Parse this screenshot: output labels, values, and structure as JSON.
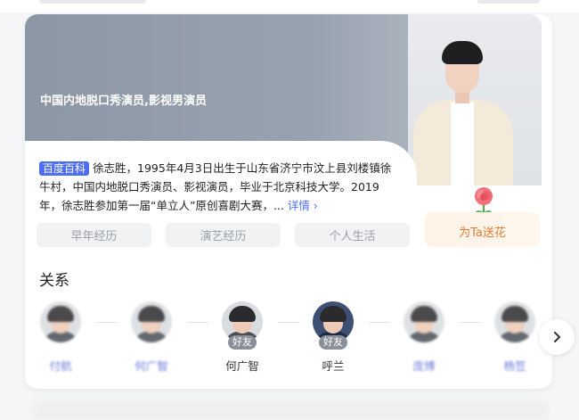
{
  "hero": {
    "tagline": "中国内地脱口秀演员,影视男演员"
  },
  "summary": {
    "badge": "百度百科",
    "text": "徐志胜，1995年4月3日出生于山东省济宁市汶上县刘楼镇徐牛村，中国内地脱口秀演员、影视演员，毕业于北京科技大学。2019年，徐志胜参加第一届“单立人”原创喜剧大赛，...",
    "more_label": "详情 ›"
  },
  "tags": [
    "早年经历",
    "演艺经历",
    "个人生活"
  ],
  "gift": {
    "label": "为Ta送花"
  },
  "relations": {
    "title": "关系",
    "items": [
      {
        "name": "付航",
        "badge": "",
        "blurred": true
      },
      {
        "name": "何广智",
        "badge": "",
        "blurred": true
      },
      {
        "name": "何广智",
        "badge": "好友",
        "blurred": false
      },
      {
        "name": "呼兰",
        "badge": "好友",
        "blurred": false
      },
      {
        "name": "庞博",
        "badge": "",
        "blurred": true
      },
      {
        "name": "杨笠",
        "badge": "",
        "blurred": true
      }
    ]
  },
  "icons": {
    "next": "chevron-right-icon",
    "rose": "rose-icon"
  },
  "colors": {
    "accent": "#4e6ef2",
    "gift_text": "#e67a2e",
    "badge_bg": "#8a8f98"
  }
}
